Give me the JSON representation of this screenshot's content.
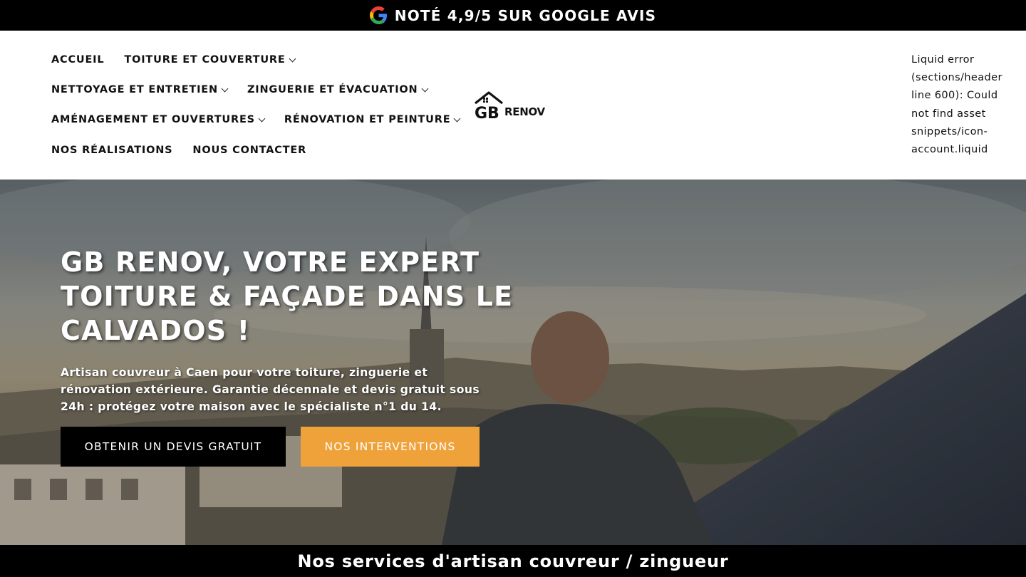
{
  "announcement": {
    "icon": "google-icon",
    "text": "NOTÉ 4,9/5 SUR GOOGLE AVIS"
  },
  "nav": {
    "rows": [
      [
        {
          "label": "ACCUEIL",
          "dropdown": false
        },
        {
          "label": "TOITURE ET COUVERTURE",
          "dropdown": true
        }
      ],
      [
        {
          "label": "NETTOYAGE ET ENTRETIEN",
          "dropdown": true
        },
        {
          "label": "ZINGUERIE ET ÉVACUATION",
          "dropdown": true
        }
      ],
      [
        {
          "label": "AMÉNAGEMENT ET OUVERTURES",
          "dropdown": true
        },
        {
          "label": "RÉNOVATION ET PEINTURE",
          "dropdown": true
        }
      ],
      [
        {
          "label": "NOS RÉALISATIONS",
          "dropdown": false
        },
        {
          "label": "NOUS CONTACTER",
          "dropdown": false
        }
      ]
    ]
  },
  "logo": {
    "mark": "GB",
    "text": "RENOV"
  },
  "header_error": "Liquid error (sections/header line 600): Could not find asset snippets/icon-account.liquid",
  "hero": {
    "title": "GB RENOV, VOTRE EXPERT TOITURE & FAÇADE DANS LE CALVADOS !",
    "subtitle": "Artisan couvreur à Caen pour votre toiture, zinguerie et rénovation extérieure. Garantie décennale et devis gratuit sous 24h : protégez votre maison avec le spécialiste n°1 du 14.",
    "primary_button": "OBTENIR UN DEVIS GRATUIT",
    "secondary_button": "NOS INTERVENTIONS"
  },
  "services": {
    "title": "Nos services d'artisan couvreur / zingueur"
  },
  "colors": {
    "topbar_bg": "#000000",
    "accent_orange": "#f0a23a",
    "primary_button_bg": "#000000"
  }
}
